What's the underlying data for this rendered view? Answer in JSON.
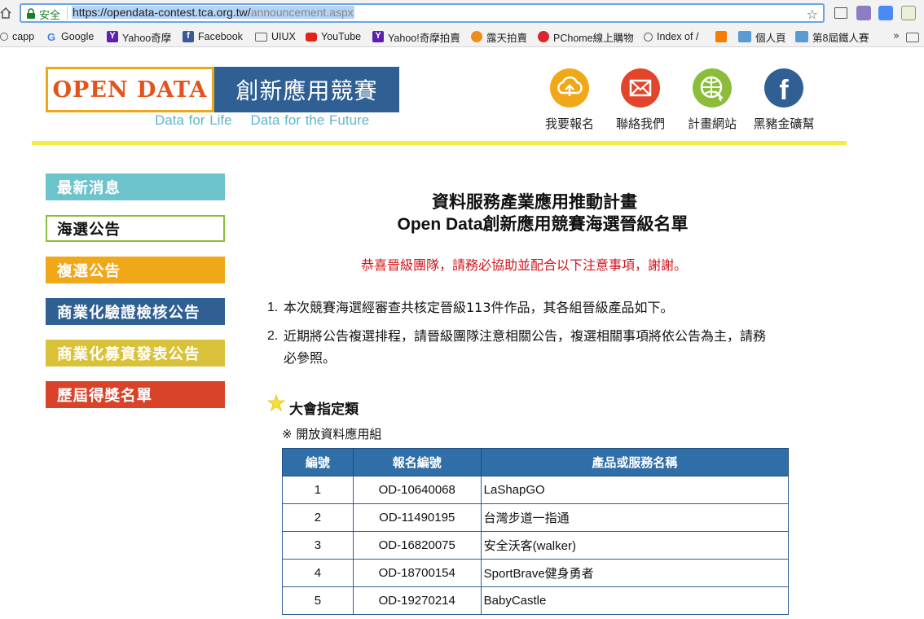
{
  "browser": {
    "secure_label": "安全",
    "url_host": "https://opendata-contest.tca.org.tw/",
    "url_path": "announcement.aspx",
    "bookmarks": [
      {
        "label": "capp",
        "icon": "globe-icon"
      },
      {
        "label": "Google",
        "icon": "google-icon"
      },
      {
        "label": "Yahoo奇摩",
        "icon": "yahoo-icon"
      },
      {
        "label": "Facebook",
        "icon": "facebook-icon"
      },
      {
        "label": "UIUX",
        "icon": "folder-icon"
      },
      {
        "label": "YouTube",
        "icon": "youtube-icon"
      },
      {
        "label": "Yahoo!奇摩拍賣",
        "icon": "yahoo-icon"
      },
      {
        "label": "露天拍賣",
        "icon": "ruten-icon"
      },
      {
        "label": "PChome線上購物",
        "icon": "pchome-icon"
      },
      {
        "label": "Index of /",
        "icon": "globe-icon"
      },
      {
        "label": "",
        "icon": "blogger-icon"
      },
      {
        "label": "個人頁",
        "icon": "site-icon"
      },
      {
        "label": "第8屆鐵人賽",
        "icon": "site-icon"
      }
    ],
    "more_label": "»"
  },
  "header": {
    "logo_left": "OPEN DATA",
    "logo_right": "創新應用競賽",
    "tagline": "Data for Life    Data for the Future",
    "buttons": [
      {
        "label": "我要報名",
        "icon": "upload-cloud-icon",
        "color": "#f0a818"
      },
      {
        "label": "聯絡我們",
        "icon": "mail-icon",
        "color": "#e2452a"
      },
      {
        "label": "計畫網站",
        "icon": "globe-cursor-icon",
        "color": "#8cbd3a"
      },
      {
        "label": "黑豬金礦幫",
        "icon": "facebook-icon",
        "color": "#2f5f93"
      }
    ]
  },
  "sidebar": {
    "items": [
      {
        "label": "最新消息",
        "color": "#6cc3cc",
        "active": false
      },
      {
        "label": "海選公告",
        "color": "#8cbd3a",
        "active": true
      },
      {
        "label": "複選公告",
        "color": "#f0a818",
        "active": false
      },
      {
        "label": "商業化驗證檢核公告",
        "color": "#2f5f93",
        "active": false
      },
      {
        "label": "商業化募資發表公告",
        "color": "#d9c23a",
        "active": false
      },
      {
        "label": "歷屆得獎名單",
        "color": "#d9432a",
        "active": false
      }
    ]
  },
  "main": {
    "title_line1": "資料服務產業應用推動計畫",
    "title_line2": "Open Data創新應用競賽海選晉級名單",
    "notice": "恭喜晉級團隊，請務必協助並配合以下注意事項，謝謝。",
    "items": [
      {
        "num": "1.",
        "text": "本次競賽海選經審查共核定晉級113件作品，其各組晉級產品如下。"
      },
      {
        "num": "2.",
        "text": "近期將公告複選排程，請晉級團隊注意相關公告，複選相關事項將依公告為主，請務必參照。"
      }
    ],
    "category_title": "大會指定類",
    "sub_title": "※ 開放資料應用組",
    "table": {
      "headers": [
        "編號",
        "報名編號",
        "產品或服務名稱"
      ],
      "rows": [
        [
          "1",
          "OD-10640068",
          "LaShapGO"
        ],
        [
          "2",
          "OD-11490195",
          "台灣步道一指通"
        ],
        [
          "3",
          "OD-16820075",
          "安全沃客(walker)"
        ],
        [
          "4",
          "OD-18700154",
          "SportBrave健身勇者"
        ],
        [
          "5",
          "OD-19270214",
          "BabyCastle"
        ]
      ]
    }
  }
}
